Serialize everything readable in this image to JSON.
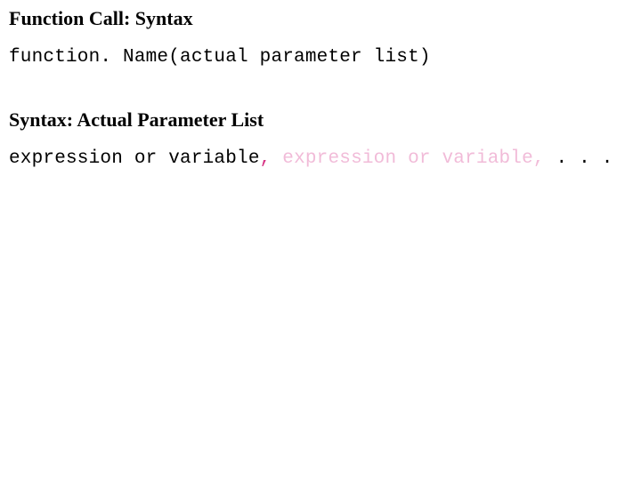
{
  "section1": {
    "heading": "Function Call: Syntax",
    "code": {
      "full": "function. Name(actual parameter list)"
    }
  },
  "section2": {
    "heading": "Syntax: Actual Parameter List",
    "code": {
      "part1": "expression or variable",
      "comma1": ", ",
      "part2": "expression or variable, ",
      "ellipsis": ". . ."
    }
  }
}
